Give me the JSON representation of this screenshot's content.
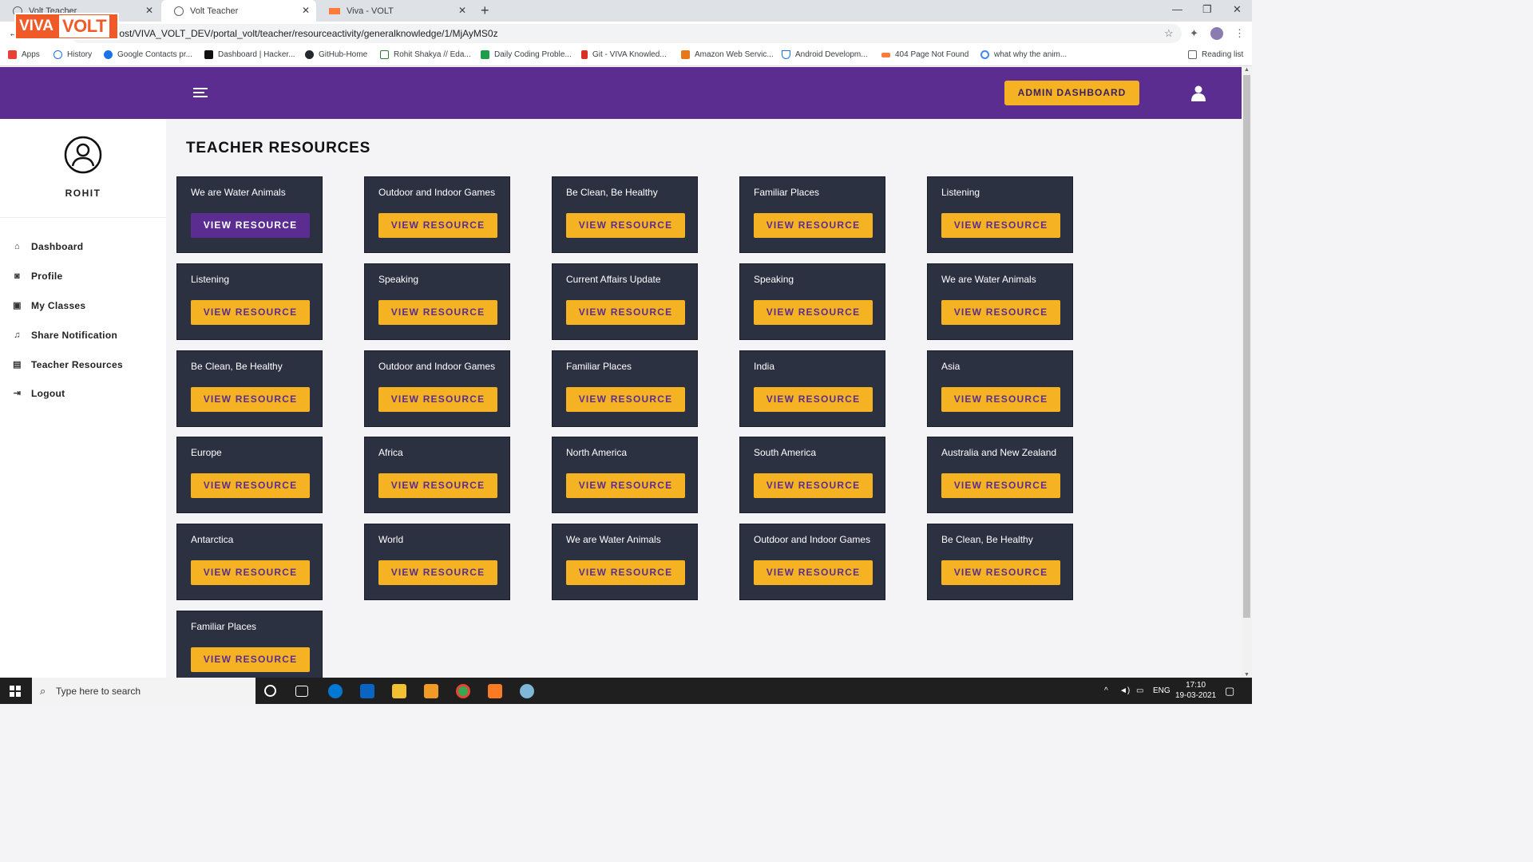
{
  "browser": {
    "tabs": [
      {
        "title": "Volt Teacher",
        "active": false
      },
      {
        "title": "Volt Teacher",
        "active": true
      },
      {
        "title": "Viva - VOLT",
        "active": false
      }
    ],
    "url": "localhost/VIVA_VOLT_DEV/portal_volt/teacher/resourceactivity/generalknowledge/1/MjAyMS0z",
    "bookmarks": [
      "Apps",
      "History",
      "Google Contacts pr...",
      "Dashboard | Hacker...",
      "GitHub-Home",
      "Rohit Shakya // Eda...",
      "Daily Coding Proble...",
      "Git - VIVA Knowled...",
      "Amazon Web Servic...",
      "Android Developm...",
      "404 Page Not Found",
      "what why the anim..."
    ],
    "reading_list": "Reading list"
  },
  "header": {
    "logo_viva": "VIVA",
    "logo_volt": "VOLT",
    "admin_button": "ADMIN DASHBOARD",
    "brand_color": "#5b2d90",
    "accent_color": "#f5b324"
  },
  "sidebar": {
    "user_name": "ROHIT",
    "items": [
      {
        "label": "Dashboard",
        "icon": "home-icon"
      },
      {
        "label": "Profile",
        "icon": "camera-icon"
      },
      {
        "label": "My Classes",
        "icon": "archive-icon"
      },
      {
        "label": "Share Notification",
        "icon": "bell-icon"
      },
      {
        "label": "Teacher Resources",
        "icon": "document-icon"
      },
      {
        "label": "Logout",
        "icon": "logout-icon"
      }
    ]
  },
  "main": {
    "title": "TEACHER RESOURCES",
    "button_label": "VIEW RESOURCE",
    "resources": [
      "We are Water Animals",
      "Outdoor and Indoor Games",
      "Be Clean, Be Healthy",
      "Familiar Places",
      "Listening",
      "Listening",
      "Speaking",
      "Current Affairs Update",
      "Speaking",
      "We are Water Animals",
      "Be Clean, Be Healthy",
      "Outdoor and Indoor Games",
      "Familiar Places",
      "India",
      "Asia",
      "Europe",
      "Africa",
      "North America",
      "South America",
      "Australia and New Zealand",
      "Antarctica",
      "World",
      "We are Water Animals",
      "Outdoor and Indoor Games",
      "Be Clean, Be Healthy",
      "Familiar Places"
    ]
  },
  "taskbar": {
    "search_placeholder": "Type here to search",
    "language": "ENG",
    "time": "17:10",
    "date": "19-03-2021"
  }
}
